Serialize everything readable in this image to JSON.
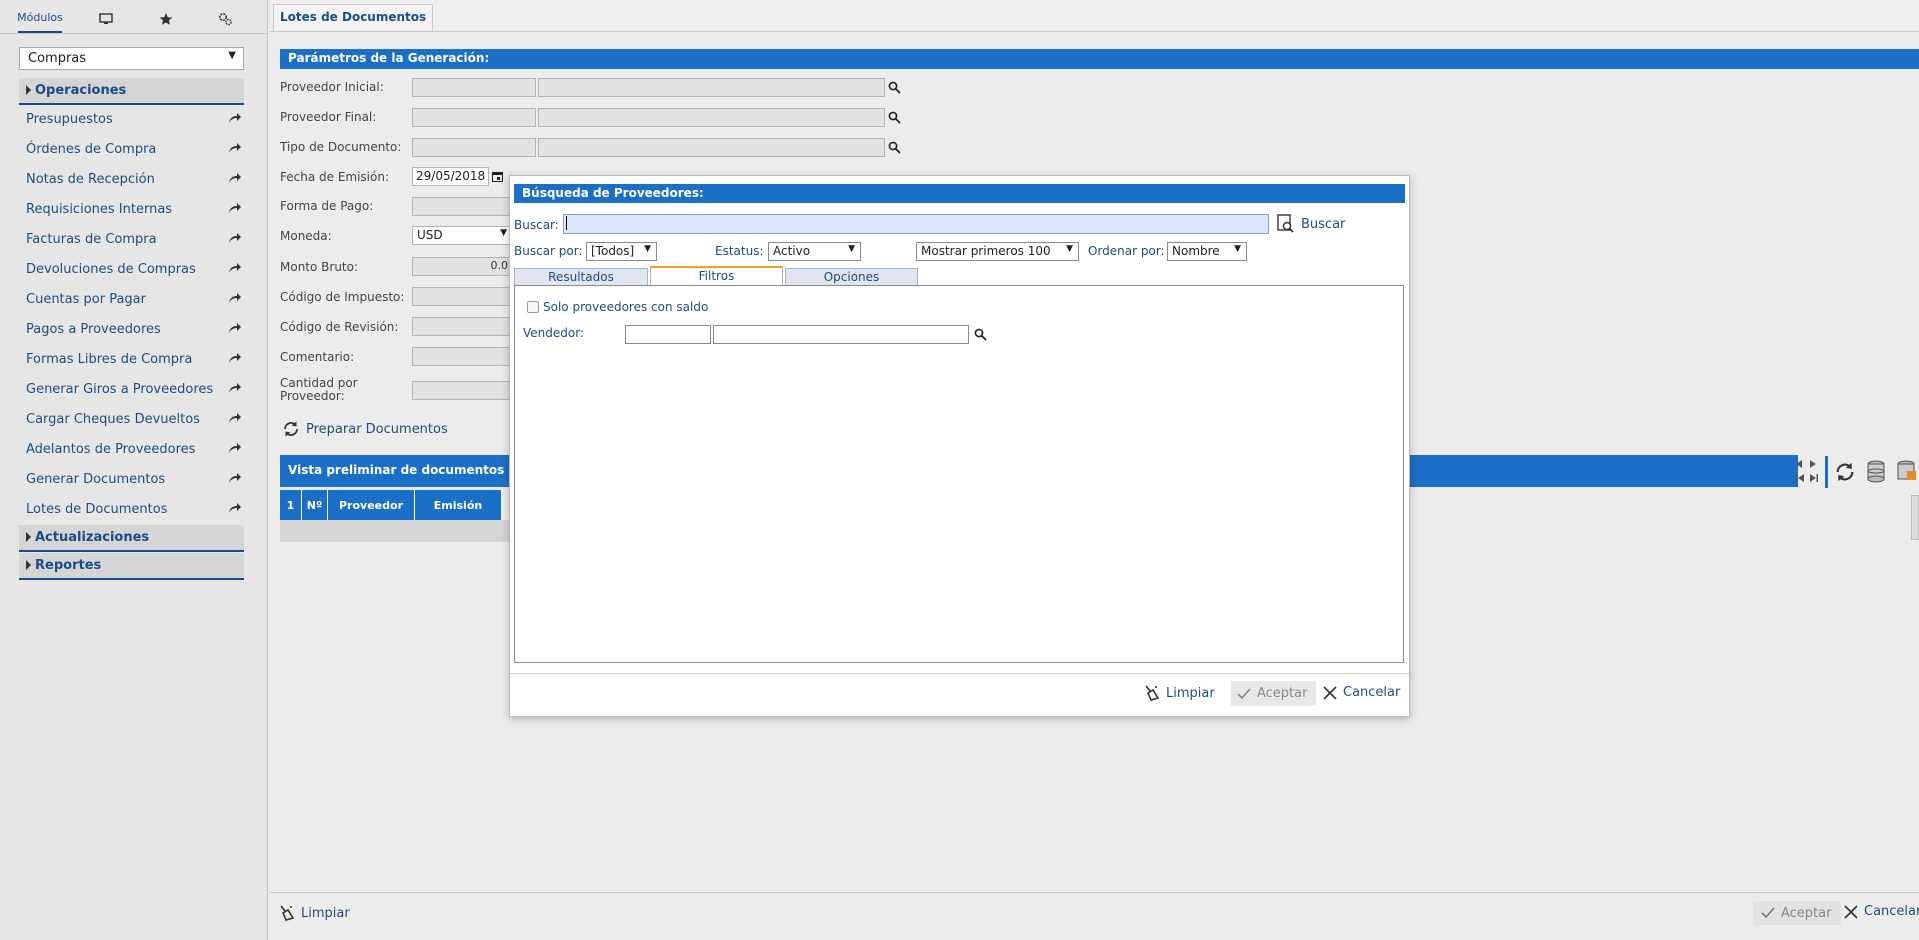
{
  "sidebar": {
    "tabs": [
      {
        "label": "Módulos",
        "icon": ""
      },
      {
        "label": "",
        "icon": "monitor-icon"
      },
      {
        "label": "",
        "icon": "star-icon"
      },
      {
        "label": "",
        "icon": "gears-icon"
      }
    ],
    "module_select": "Compras",
    "sections": {
      "operaciones": "Operaciones",
      "actualizaciones": "Actualizaciones",
      "reportes": "Reportes"
    },
    "items": [
      "Presupuestos",
      "Órdenes de Compra",
      "Notas de Recepción",
      "Requisiciones Internas",
      "Facturas de Compra",
      "Devoluciones de Compras",
      "Cuentas por Pagar",
      "Pagos a Proveedores",
      "Formas Libres de Compra",
      "Generar Giros a Proveedores",
      "Cargar Cheques Devueltos",
      "Adelantos de Proveedores",
      "Generar Documentos",
      "Lotes de Documentos"
    ]
  },
  "main": {
    "tab": "Lotes de Documentos",
    "params_header": "Parámetros de la Generación:",
    "labels": {
      "proveedor_inicial": "Proveedor Inicial:",
      "proveedor_final": "Proveedor Final:",
      "tipo_documento": "Tipo de Documento:",
      "fecha_emision": "Fecha de Emisión:",
      "forma_pago": "Forma de Pago:",
      "moneda": "Moneda:",
      "monto_bruto": "Monto Bruto:",
      "codigo_impuesto": "Código de Impuesto:",
      "codigo_revision": "Código de Revisión:",
      "comentario": "Comentario:",
      "cantidad_por_proveedor": "Cantidad por Proveedor:"
    },
    "values": {
      "fecha_emision": "29/05/2018",
      "moneda": "USD",
      "monto_bruto": "0.0"
    },
    "prepare_button": "Preparar Documentos",
    "preview_header": "Vista preliminar de documentos a",
    "grid_columns": [
      "1",
      "Nº",
      "Proveedor",
      "Emisión"
    ],
    "footer": {
      "limpiar": "Limpiar",
      "aceptar": "Aceptar",
      "cancelar": "Cancelar"
    }
  },
  "dialog": {
    "title": "Búsqueda de Proveedores:",
    "buscar_label": "Buscar:",
    "buscar_value": "",
    "buscar_button": "Buscar",
    "buscar_por_label": "Buscar por:",
    "buscar_por_value": "[Todos]",
    "estatus_label": "Estatus:",
    "estatus_value": "Activo",
    "mostrar_value": "Mostrar primeros 100",
    "ordenar_label": "Ordenar por:",
    "ordenar_value": "Nombre",
    "tabs": [
      "Resultados",
      "Filtros",
      "Opciones"
    ],
    "active_tab": "Filtros",
    "solo_saldo_label": "Solo proveedores con saldo",
    "solo_saldo_checked": false,
    "vendedor_label": "Vendedor:",
    "footer": {
      "limpiar": "Limpiar",
      "aceptar": "Aceptar",
      "cancelar": "Cancelar"
    }
  },
  "colors": {
    "header_blue": "#1c6fc6",
    "link_blue": "#1f4d80",
    "tab_accent": "#f0a020"
  }
}
